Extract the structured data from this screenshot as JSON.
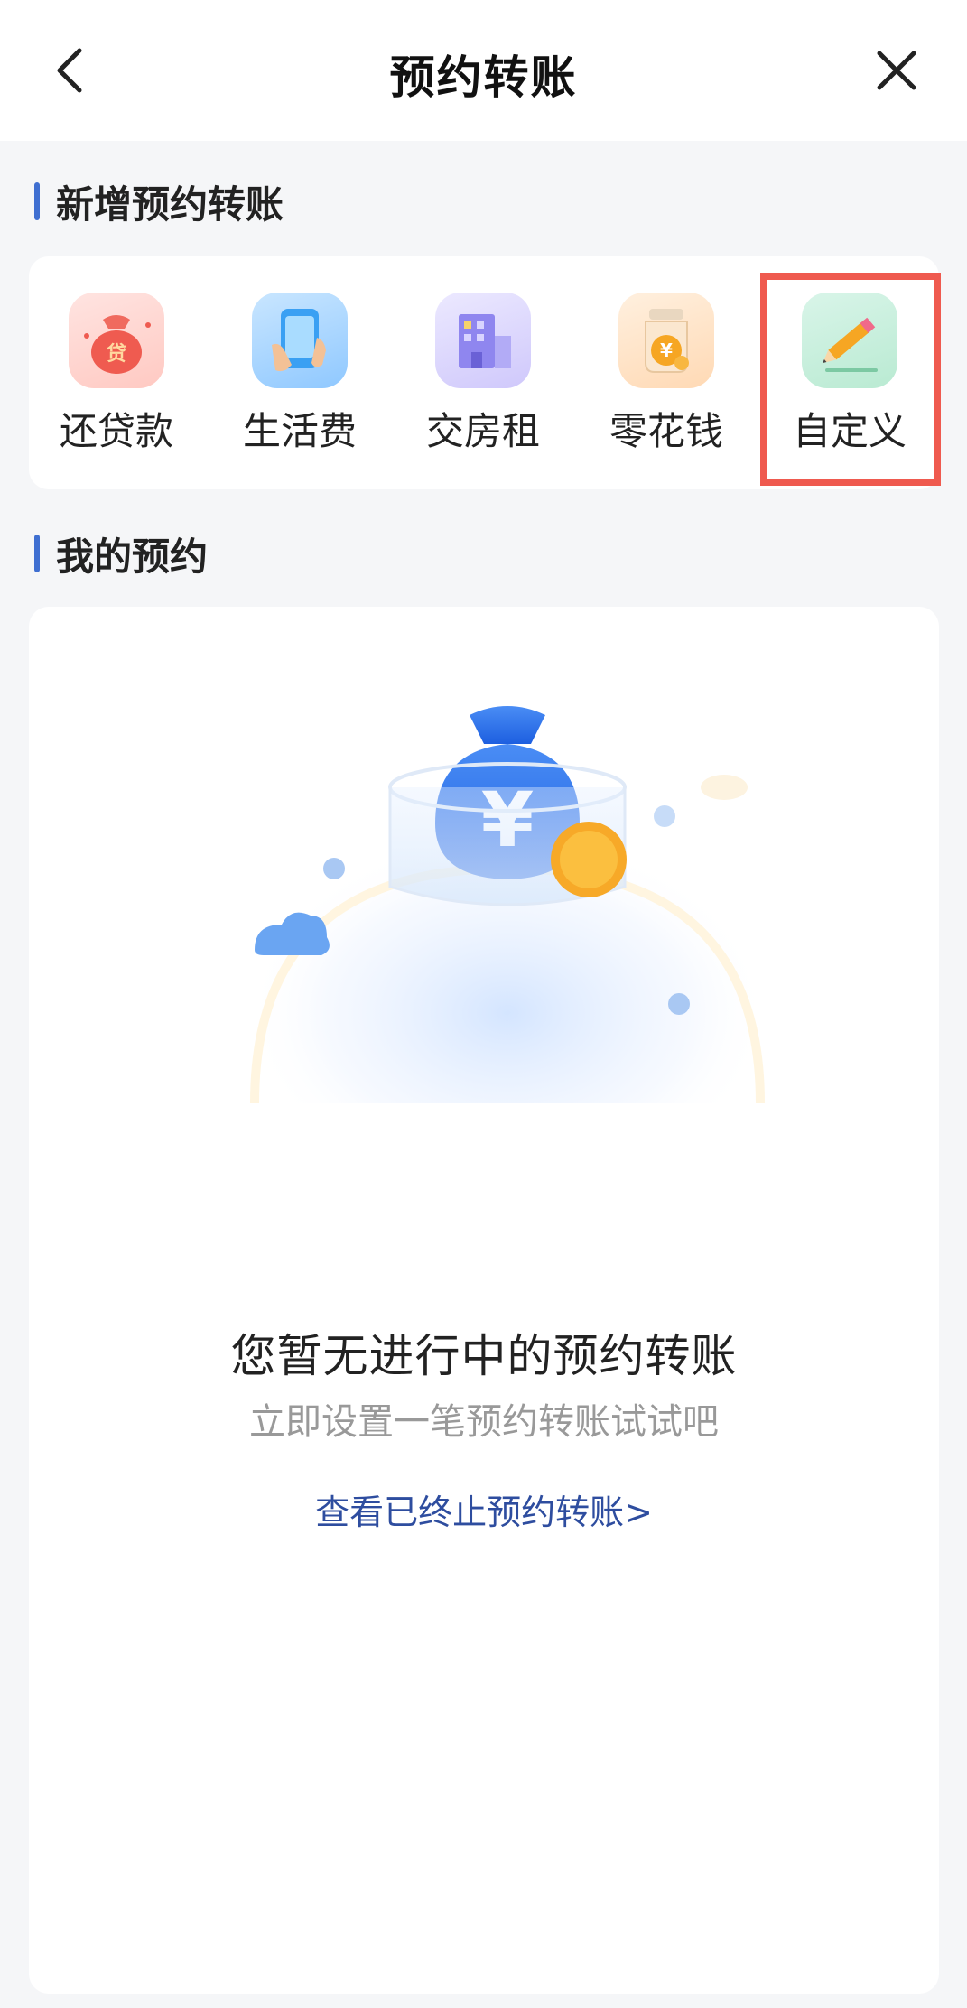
{
  "header": {
    "title": "预约转账",
    "back_icon": "chevron-left-icon",
    "close_icon": "close-icon"
  },
  "new_section": {
    "title": "新增预约转账",
    "items": [
      {
        "label": "还贷款",
        "icon": "loan-bag-icon"
      },
      {
        "label": "生活费",
        "icon": "phone-hand-icon"
      },
      {
        "label": "交房租",
        "icon": "building-icon"
      },
      {
        "label": "零花钱",
        "icon": "coin-jar-icon"
      },
      {
        "label": "自定义",
        "icon": "pencil-icon"
      }
    ],
    "highlighted_item": "自定义"
  },
  "my_section": {
    "title": "我的预约",
    "empty_title": "您暂无进行中的预约转账",
    "empty_sub": "立即设置一笔预约转账试试吧",
    "link_text": "查看已终止预约转账>"
  },
  "colors": {
    "accent": "#3f6fd1",
    "link": "#2e4d9f",
    "highlight": "#ef5a4f"
  }
}
